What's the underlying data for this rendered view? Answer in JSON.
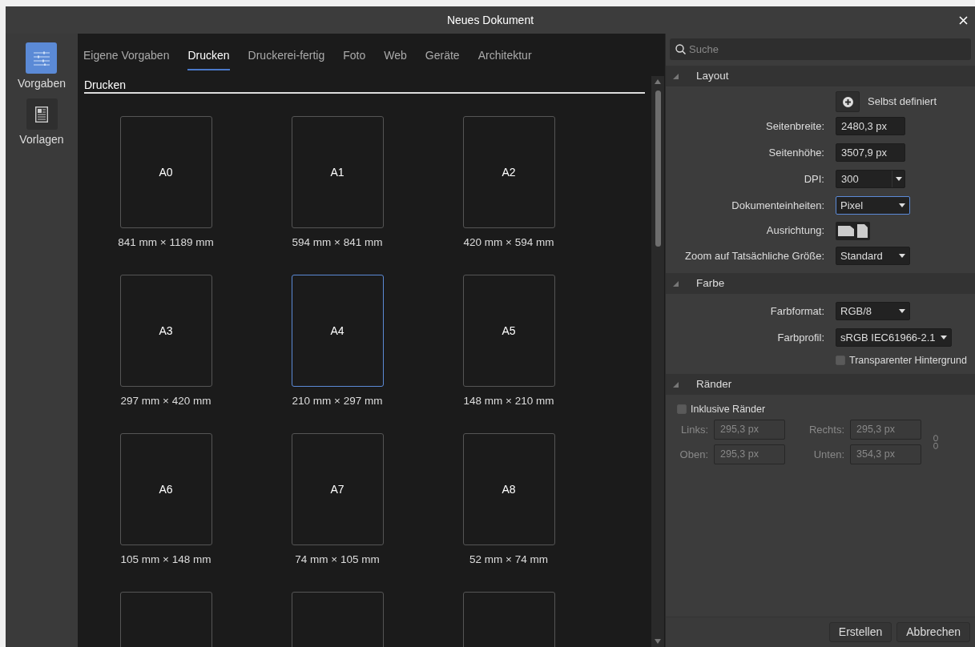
{
  "window": {
    "title": "Neues Dokument"
  },
  "sidebar": {
    "items": [
      {
        "label": "Vorgaben",
        "selected": true,
        "kind": "presets"
      },
      {
        "label": "Vorlagen",
        "selected": false,
        "kind": "templates"
      }
    ]
  },
  "tabs": [
    {
      "label": "Eigene Vorgaben",
      "selected": false
    },
    {
      "label": "Drucken",
      "selected": true
    },
    {
      "label": "Druckerei-fertig",
      "selected": false
    },
    {
      "label": "Foto",
      "selected": false
    },
    {
      "label": "Web",
      "selected": false
    },
    {
      "label": "Geräte",
      "selected": false
    },
    {
      "label": "Architektur",
      "selected": false
    }
  ],
  "section_title": "Drucken",
  "presets": [
    {
      "name": "A0",
      "size": "841 mm × 1189 mm",
      "selected": false
    },
    {
      "name": "A1",
      "size": "594 mm × 841 mm",
      "selected": false
    },
    {
      "name": "A2",
      "size": "420 mm × 594 mm",
      "selected": false
    },
    {
      "name": "A3",
      "size": "297 mm × 420 mm",
      "selected": false
    },
    {
      "name": "A4",
      "size": "210 mm × 297 mm",
      "selected": true
    },
    {
      "name": "A5",
      "size": "148 mm × 210 mm",
      "selected": false
    },
    {
      "name": "A6",
      "size": "105 mm × 148 mm",
      "selected": false
    },
    {
      "name": "A7",
      "size": "74 mm × 105 mm",
      "selected": false
    },
    {
      "name": "A8",
      "size": "52 mm × 74 mm",
      "selected": false
    },
    {
      "selected": false
    },
    {
      "selected": false
    },
    {
      "selected": false
    }
  ],
  "search": {
    "placeholder": "Suche"
  },
  "sections": [
    {
      "title": "Layout",
      "expanded": true,
      "rows": [
        {
          "kind": "button",
          "text": "Selbst definiert"
        },
        {
          "kind": "input",
          "label": "Seitenbreite:",
          "value": "2480,3 px"
        },
        {
          "kind": "input",
          "label": "Seitenhöhe:",
          "value": "3507,9 px"
        },
        {
          "kind": "combo",
          "label": "DPI:",
          "value": "300"
        },
        {
          "kind": "select",
          "label": "Dokumenteinheiten:",
          "value": "Pixel",
          "focused": true
        },
        {
          "kind": "orientation",
          "label": "Ausrichtung:"
        },
        {
          "kind": "select",
          "label": "Zoom auf Tatsächliche Größe:",
          "value": "Standard",
          "focused": false
        }
      ]
    },
    {
      "title": "Farbe",
      "expanded": true,
      "rows": [
        {
          "kind": "select",
          "label": "Farbformat:",
          "value": "RGB/8",
          "focused": false
        },
        {
          "kind": "select",
          "label": "Farbprofil:",
          "value": "sRGB IEC61966-2.1",
          "focused": false
        },
        {
          "kind": "checkbox",
          "text": "Transparenter Hintergrund",
          "checked": false
        }
      ]
    },
    {
      "title": "Ränder",
      "expanded": true,
      "rows": [
        {
          "kind": "leftcheck",
          "text": "Inklusive Ränder",
          "checked": false
        },
        {
          "kind": "margins",
          "disabled": true,
          "fields": [
            {
              "label": "Links:",
              "value": "295,3 px"
            },
            {
              "label": "Rechts:",
              "value": "295,3 px"
            },
            {
              "label": "Oben:",
              "value": "295,3 px"
            },
            {
              "label": "Unten:",
              "value": "354,3 px"
            }
          ]
        }
      ]
    }
  ],
  "buttons": [
    "Erstellen",
    "Abbrechen"
  ]
}
